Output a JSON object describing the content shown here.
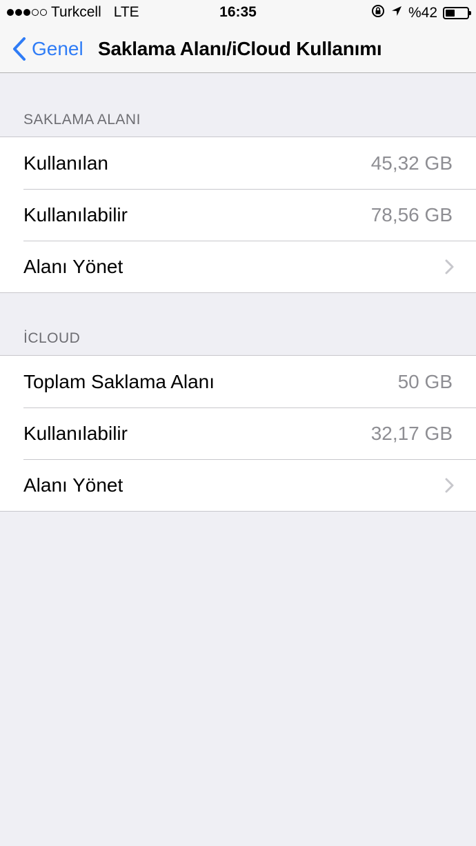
{
  "status_bar": {
    "carrier": "Turkcell",
    "network": "LTE",
    "time": "16:35",
    "battery_text": "%42",
    "battery_level": 0.42,
    "signal_filled": 3,
    "signal_total": 5
  },
  "nav": {
    "back_label": "Genel",
    "title": "Saklama Alanı/iCloud Kullanımı"
  },
  "storage_section": {
    "header": "SAKLAMA ALANI",
    "rows": [
      {
        "label": "Kullanılan",
        "value": "45,32 GB"
      },
      {
        "label": "Kullanılabilir",
        "value": "78,56 GB"
      },
      {
        "label": "Alanı Yönet"
      }
    ]
  },
  "icloud_section": {
    "header": "İCLOUD",
    "rows": [
      {
        "label": "Toplam Saklama Alanı",
        "value": "50 GB"
      },
      {
        "label": "Kullanılabilir",
        "value": "32,17 GB"
      },
      {
        "label": "Alanı Yönet"
      }
    ]
  },
  "colors": {
    "accent": "#2f7cf6",
    "background": "#efeff4",
    "secondary_text": "#8e8e93"
  }
}
